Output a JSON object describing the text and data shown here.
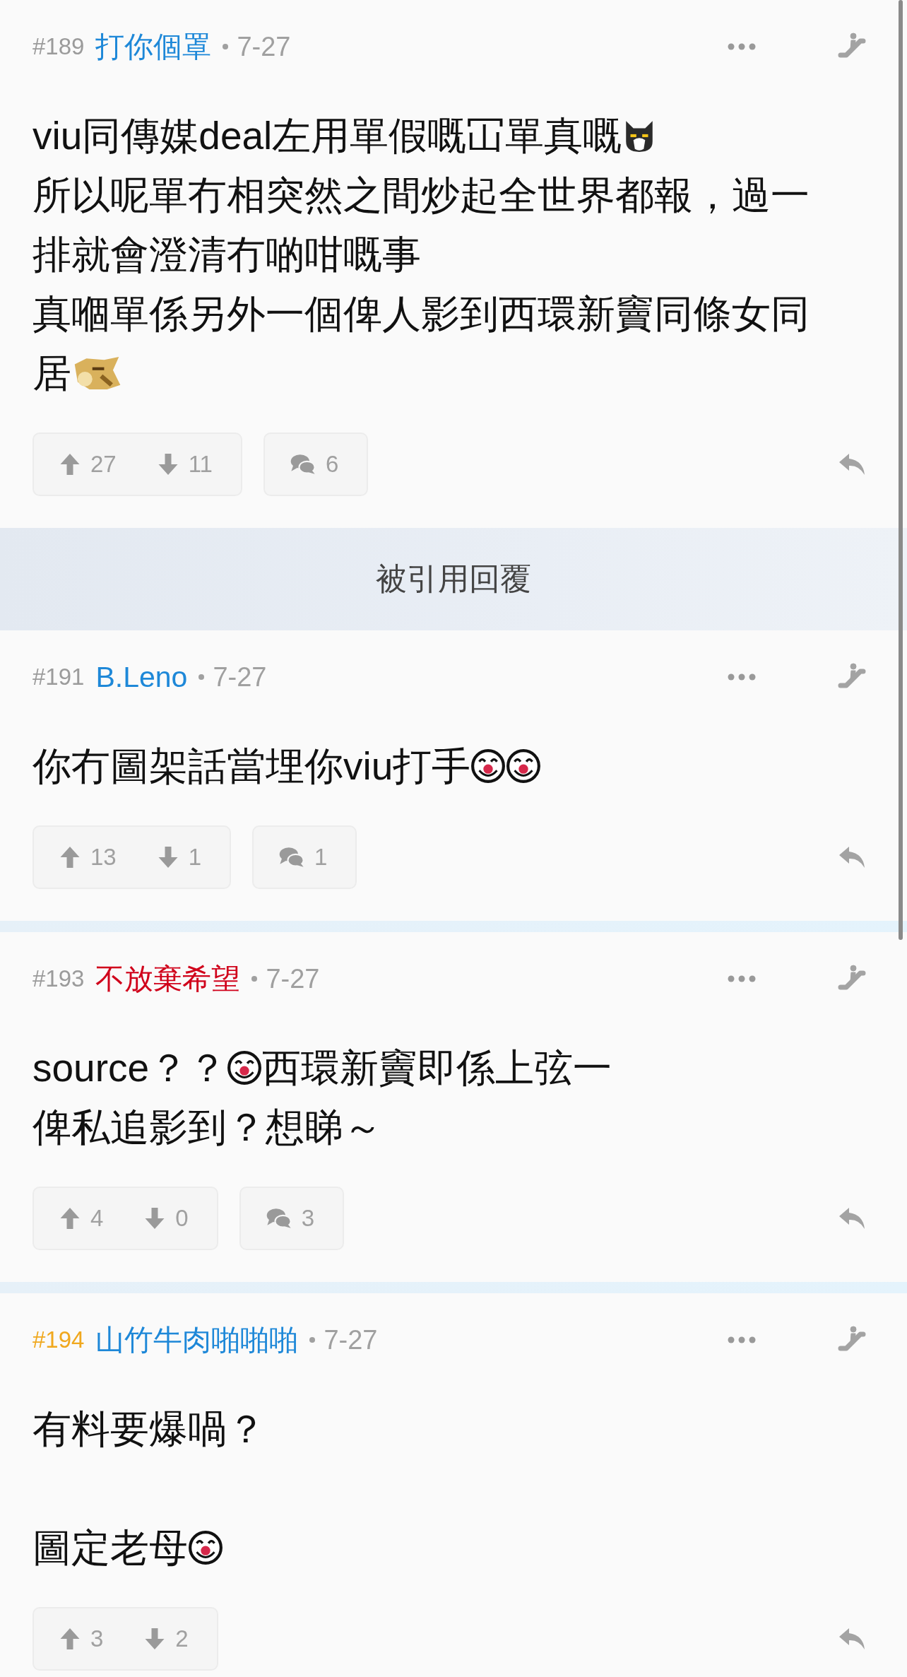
{
  "posts": [
    {
      "number": {
        "text": "#189",
        "color": "#9b9b9b"
      },
      "author": {
        "name": "打你個罩",
        "color": "#1e88d8"
      },
      "date": "7-27",
      "body": [
        {
          "kind": "text",
          "text": "viu同傳媒deal左用單假嘅冚單真嘅"
        },
        {
          "kind": "cat"
        },
        {
          "kind": "break"
        },
        {
          "kind": "text",
          "text": "所以呢單冇相突然之間炒起全世界都報，過一排就會澄清冇啲咁嘅事"
        },
        {
          "kind": "break"
        },
        {
          "kind": "text",
          "text": "真嗰單係另外一個俾人影到西環新竇同條女同居"
        },
        {
          "kind": "dog"
        }
      ],
      "up": "27",
      "down": "11",
      "comments": "6"
    },
    {
      "kind": "banner",
      "text": "被引用回覆"
    },
    {
      "number": {
        "text": "#191",
        "color": "#9b9b9b"
      },
      "author": {
        "name": "B.Leno",
        "color": "#1e88d8"
      },
      "date": "7-27",
      "body": [
        {
          "kind": "text",
          "text": "你冇圖架話當埋你viu打手"
        },
        {
          "kind": "clown"
        },
        {
          "kind": "clown"
        }
      ],
      "up": "13",
      "down": "1",
      "comments": "1"
    },
    {
      "number": {
        "text": "#193",
        "color": "#9b9b9b"
      },
      "author": {
        "name": "不放棄希望",
        "color": "#d0021b"
      },
      "date": "7-27",
      "body": [
        {
          "kind": "text",
          "text": "source？？"
        },
        {
          "kind": "clown"
        },
        {
          "kind": "text",
          "text": "西環新竇即係上弦一"
        },
        {
          "kind": "break"
        },
        {
          "kind": "text",
          "text": "俾私追影到？想睇～"
        }
      ],
      "up": "4",
      "down": "0",
      "comments": "3"
    },
    {
      "number": {
        "text": "#194",
        "color": "#f0a81e"
      },
      "author": {
        "name": "山竹牛肉啪啪啪",
        "color": "#1e88d8"
      },
      "date": "7-27",
      "body": [
        {
          "kind": "text",
          "text": "有料要爆喎？"
        },
        {
          "kind": "break"
        },
        {
          "kind": "break"
        },
        {
          "kind": "text",
          "text": "圖定老母"
        },
        {
          "kind": "clown"
        }
      ],
      "up": "3",
      "down": "2"
    }
  ]
}
